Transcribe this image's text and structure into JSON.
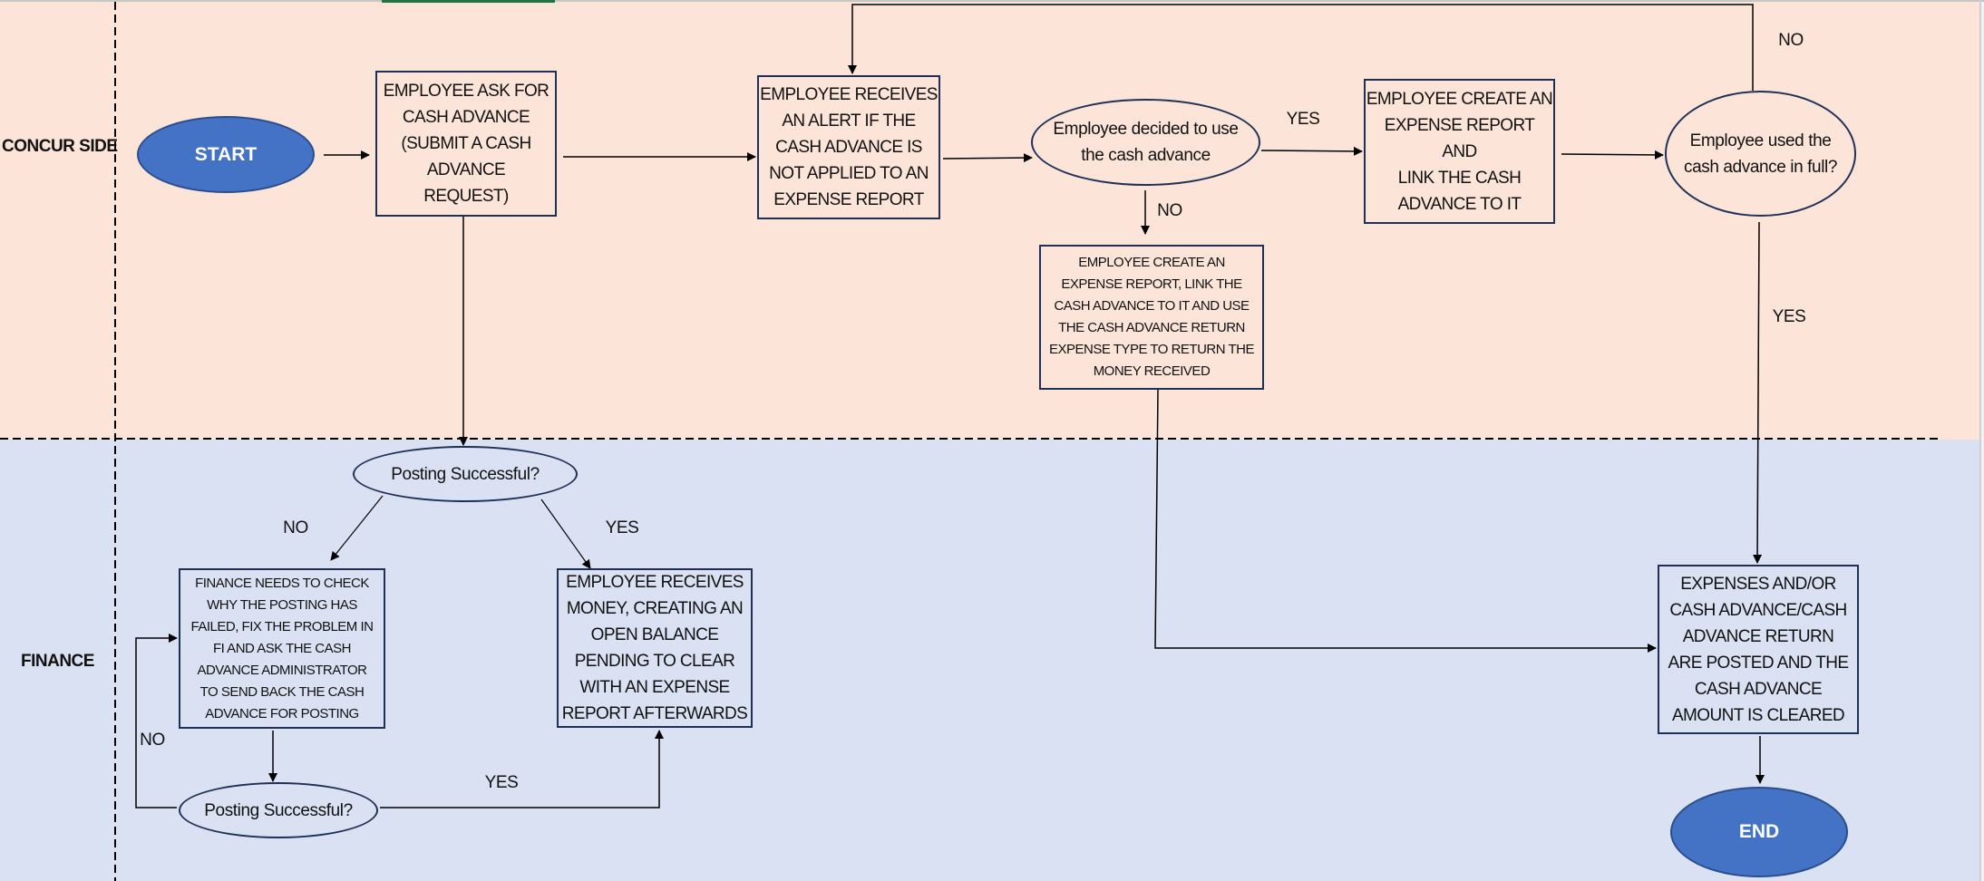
{
  "lanes": {
    "concur": "CONCUR SIDE",
    "finance": "FINANCE"
  },
  "nodes": {
    "start": "START",
    "ask_cash_advance": "EMPLOYEE ASK FOR\nCASH ADVANCE\n(SUBMIT A CASH\nADVANCE\nREQUEST)",
    "receives_alert": "EMPLOYEE RECEIVES\nAN ALERT IF THE\nCASH ADVANCE IS\nNOT APPLIED TO AN\nEXPENSE REPORT",
    "decided_to_use": "Employee decided to use\nthe cash advance",
    "create_report_link": "EMPLOYEE CREATE AN\nEXPENSE REPORT AND\nLINK THE CASH\nADVANCE TO IT",
    "used_in_full": "Employee used the\ncash advance in full?",
    "create_report_return": "EMPLOYEE CREATE AN\nEXPENSE REPORT, LINK THE\nCASH ADVANCE TO IT AND USE\nTHE CASH ADVANCE RETURN\nEXPENSE TYPE TO RETURN THE\nMONEY RECEIVED",
    "posting_successful_1": "Posting Successful?",
    "finance_check": "FINANCE NEEDS TO CHECK\nWHY THE POSTING HAS\nFAILED, FIX THE PROBLEM IN\nFI AND ASK THE CASH\nADVANCE ADMINISTRATOR\nTO SEND BACK THE CASH\nADVANCE FOR POSTING",
    "receives_money": "EMPLOYEE RECEIVES\nMONEY, CREATING AN\nOPEN BALANCE\nPENDING TO CLEAR\nWITH AN EXPENSE\nREPORT AFTERWARDS",
    "posting_successful_2": "Posting Successful?",
    "posted_cleared": "EXPENSES AND/OR\nCASH ADVANCE/CASH\nADVANCE RETURN\nARE POSTED AND THE\nCASH ADVANCE\nAMOUNT IS CLEARED",
    "end": "END"
  },
  "edge_labels": {
    "decided_yes": "YES",
    "decided_no": "NO",
    "full_no": "NO",
    "full_yes": "YES",
    "posting1_no": "NO",
    "posting1_yes": "YES",
    "posting2_no": "NO",
    "posting2_yes": "YES"
  },
  "colors": {
    "concur_lane": "#fde4d8",
    "finance_lane": "#dae1f2",
    "terminal_fill": "#4472c4",
    "shape_border": "#1f3057",
    "active_cell": "#217346"
  }
}
